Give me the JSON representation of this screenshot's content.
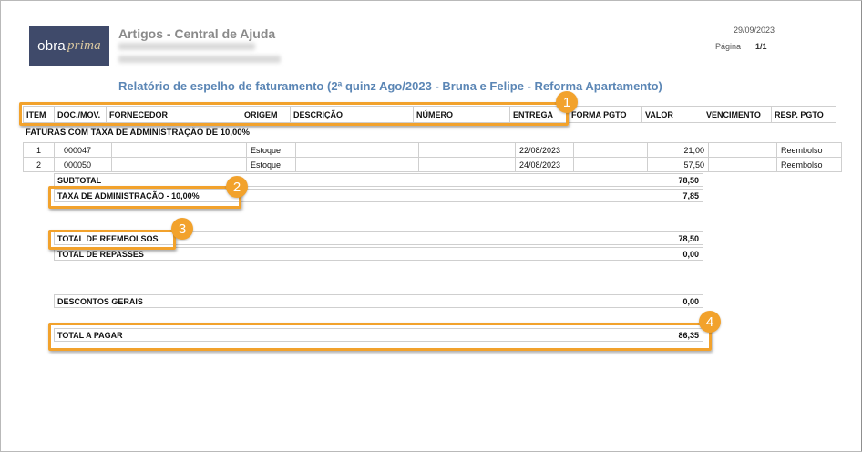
{
  "logo": {
    "part1": "obra",
    "part2": "prima"
  },
  "header": {
    "company": "Artigos - Central de Ajuda",
    "date": "29/09/2023",
    "page_label": "Página",
    "page_value": "1/1"
  },
  "report_title": "Relatório de espelho de faturamento (2ª quinz Ago/2023 - Bruna e Felipe - Reforma Apartamento)",
  "columns": [
    "ITEM",
    "DOC./MOV.",
    "FORNECEDOR",
    "ORIGEM",
    "DESCRIÇÃO",
    "NÚMERO",
    "ENTREGA",
    "FORMA PGTO",
    "VALOR",
    "VENCIMENTO",
    "RESP. PGTO"
  ],
  "section_title": "FATURAS COM TAXA DE ADMINISTRAÇÃO DE 10,00%",
  "rows": [
    {
      "item": "1",
      "doc": "000047",
      "fornecedor": "",
      "origem": "Estoque",
      "descricao": "",
      "numero": "",
      "entrega": "22/08/2023",
      "forma": "",
      "valor": "21,00",
      "vencimento": "",
      "resp": "Reembolso"
    },
    {
      "item": "2",
      "doc": "000050",
      "fornecedor": "",
      "origem": "Estoque",
      "descricao": "",
      "numero": "",
      "entrega": "24/08/2023",
      "forma": "",
      "valor": "57,50",
      "vencimento": "",
      "resp": "Reembolso"
    }
  ],
  "totals": {
    "subtotal": {
      "label": "SUBTOTAL",
      "value": "78,50"
    },
    "taxa": {
      "label": "TAXA DE ADMINISTRAÇÃO - 10,00%",
      "value": "7,85"
    },
    "reembolsos": {
      "label": "TOTAL DE REEMBOLSOS",
      "value": "78,50"
    },
    "repasses": {
      "label": "TOTAL DE REPASSES",
      "value": "0,00"
    },
    "descontos": {
      "label": "DESCONTOS GERAIS",
      "value": "0,00"
    },
    "pagar": {
      "label": "TOTAL A PAGAR",
      "value": "86,35"
    }
  },
  "badges": [
    "1",
    "2",
    "3",
    "4"
  ],
  "colors": {
    "highlight": "#f2a22c",
    "title": "#5b86b5",
    "logo_bg": "#3f4a6a"
  }
}
